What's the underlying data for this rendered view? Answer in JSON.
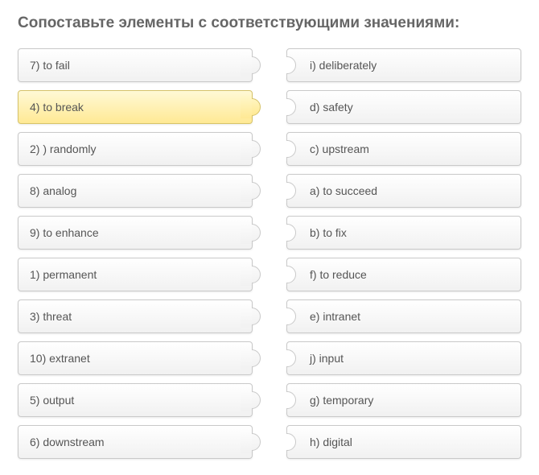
{
  "title": "Сопоставьте элементы с соответствующими значениями:",
  "left": [
    {
      "label": "7) to fail",
      "selected": false
    },
    {
      "label": "4) to break",
      "selected": true
    },
    {
      "label": "2) ) randomly",
      "selected": false
    },
    {
      "label": "8) analog",
      "selected": false
    },
    {
      "label": "9) to enhance",
      "selected": false
    },
    {
      "label": "1) permanent",
      "selected": false
    },
    {
      "label": "3) threat",
      "selected": false
    },
    {
      "label": "10) extranet",
      "selected": false
    },
    {
      "label": "5) output",
      "selected": false
    },
    {
      "label": "6) downstream",
      "selected": false
    }
  ],
  "right": [
    {
      "label": "i) deliberately"
    },
    {
      "label": "d) safety"
    },
    {
      "label": "c) upstream"
    },
    {
      "label": "a) to succeed"
    },
    {
      "label": "b) to fix"
    },
    {
      "label": "f) to reduce"
    },
    {
      "label": "e) intranet"
    },
    {
      "label": "j) input"
    },
    {
      "label": "g) temporary"
    },
    {
      "label": "h) digital"
    }
  ]
}
